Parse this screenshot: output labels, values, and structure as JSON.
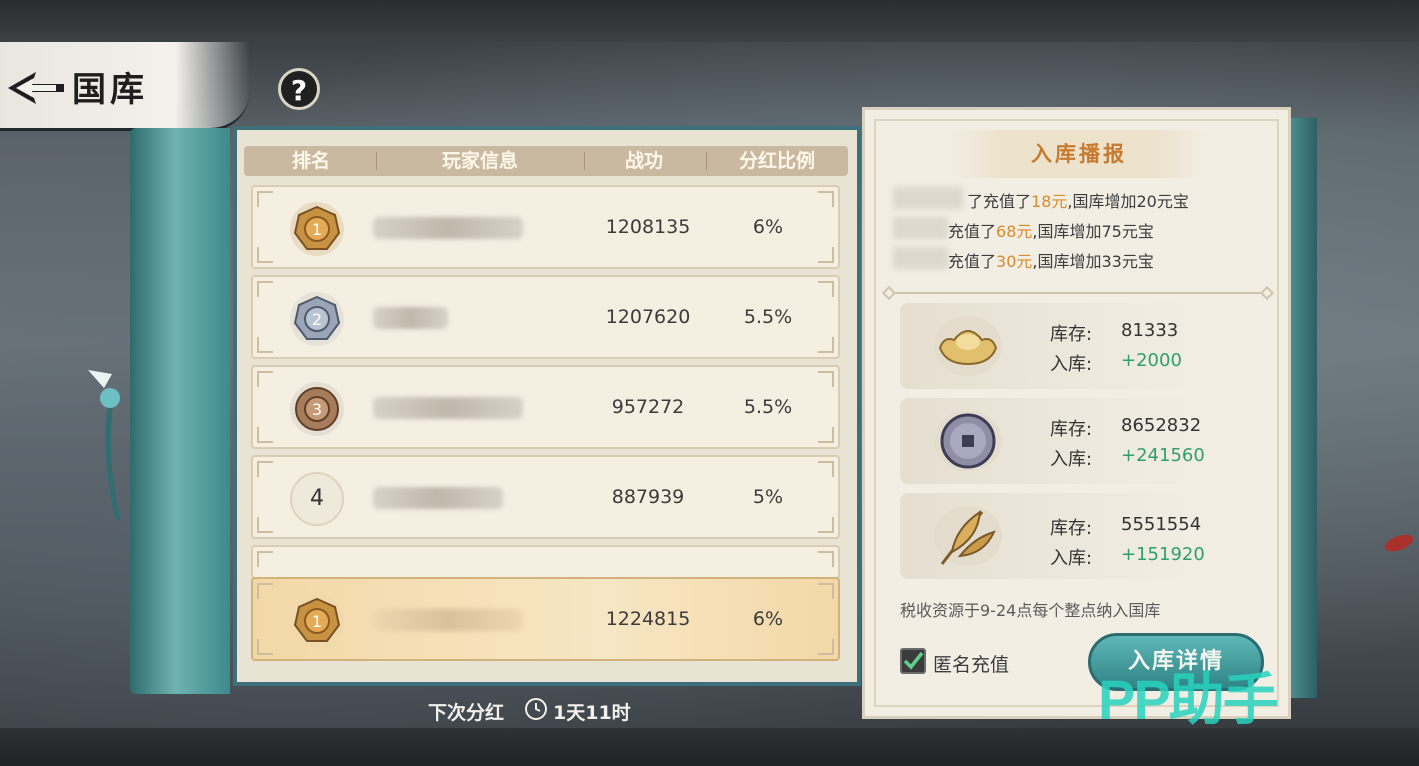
{
  "header": {
    "title": "国库",
    "help_label": "?"
  },
  "table": {
    "headers": [
      "排名",
      "玩家信息",
      "战功",
      "分红比例"
    ],
    "rows": [
      {
        "rank": "1",
        "medal": "gold",
        "power": "1208135",
        "ratio": "6%"
      },
      {
        "rank": "2",
        "medal": "silver",
        "power": "1207620",
        "ratio": "5.5%"
      },
      {
        "rank": "3",
        "medal": "bronze",
        "power": "957272",
        "ratio": "5.5%"
      },
      {
        "rank": "4",
        "medal": "plain",
        "power": "887939",
        "ratio": "5%"
      }
    ],
    "self_row": {
      "rank": "1",
      "medal": "gold",
      "power": "1224815",
      "ratio": "6%"
    }
  },
  "footer": {
    "next_dividend_label": "下次分红",
    "next_dividend_time": "1天11时"
  },
  "broadcast": {
    "title": "入库播报",
    "entries": [
      {
        "prefix": "了充值了",
        "amount": "18元",
        "suffix": ",国库增加20元宝"
      },
      {
        "prefix": "充值了",
        "amount": "68元",
        "suffix": ",国库增加75元宝"
      },
      {
        "prefix": "充值了",
        "amount": "30元",
        "suffix": ",国库增加33元宝"
      }
    ],
    "resources": [
      {
        "icon": "gold-ingot-icon",
        "stock_label": "库存:",
        "stock": "81333",
        "in_label": "入库:",
        "in": "+2000"
      },
      {
        "icon": "copper-coin-icon",
        "stock_label": "库存:",
        "stock": "8652832",
        "in_label": "入库:",
        "in": "+241560"
      },
      {
        "icon": "grain-icon",
        "stock_label": "库存:",
        "stock": "5551554",
        "in_label": "入库:",
        "in": "+151920"
      }
    ],
    "tax_note": "税收资源于9-24点每个整点纳入国库",
    "anonymous_label": "匿名充值",
    "anonymous_checked": true,
    "detail_button": "入库详情"
  },
  "watermark": "PP助手",
  "colors": {
    "highlight": "#d98a2a",
    "gain": "#2fa06a",
    "title": "#c77b2f",
    "button": "#2f8486"
  }
}
